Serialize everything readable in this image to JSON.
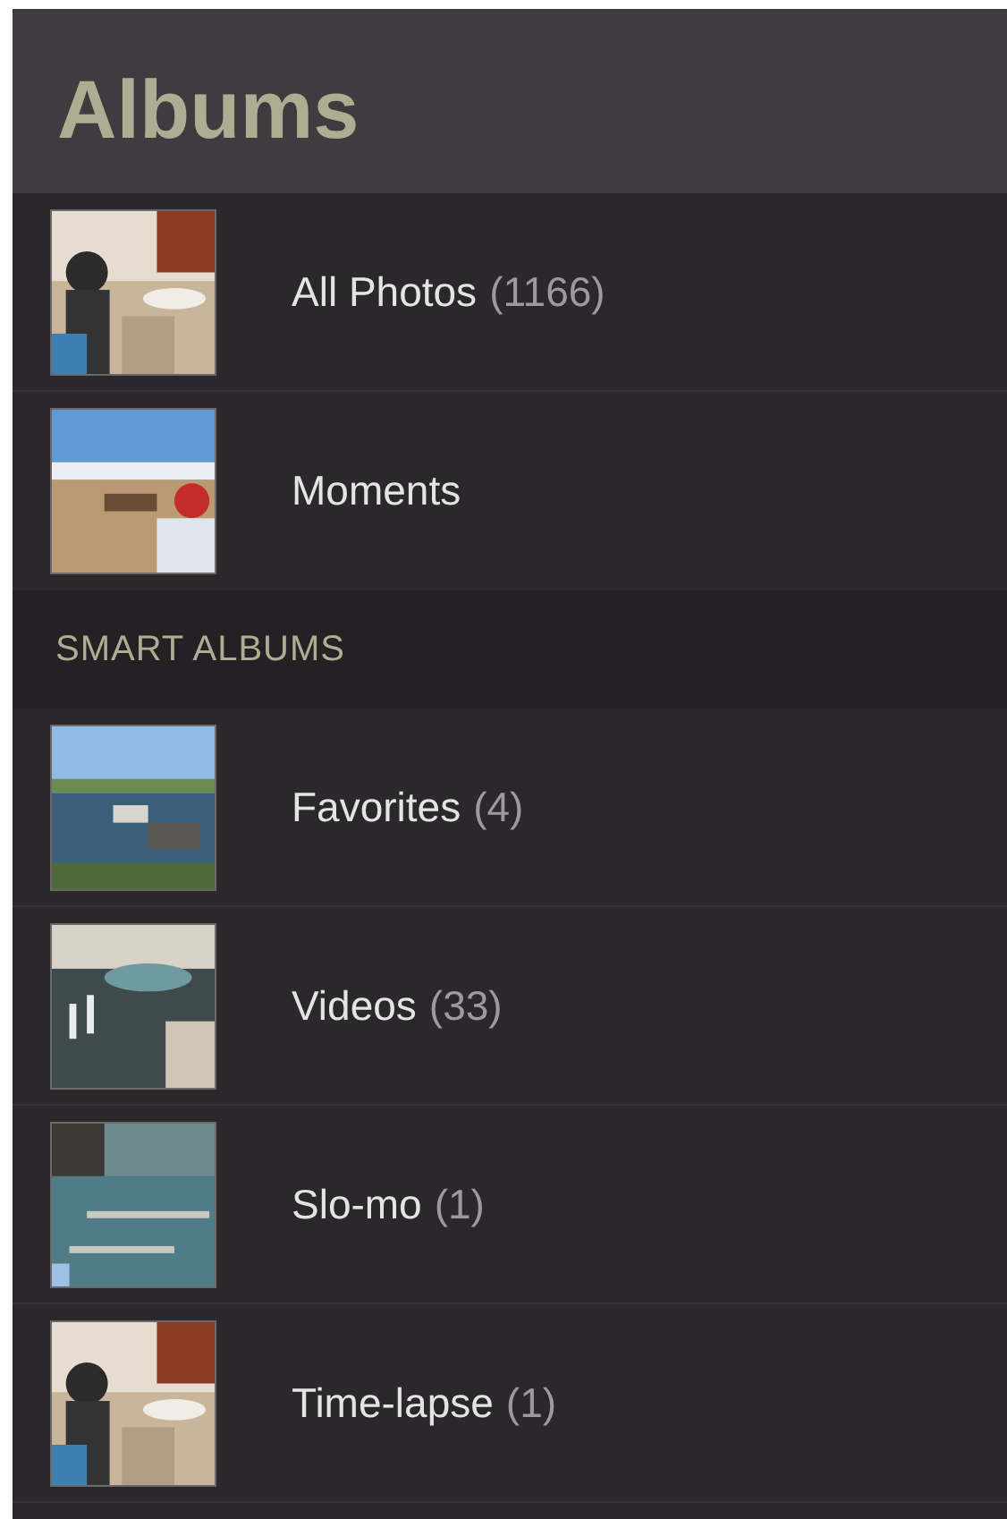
{
  "title": "Albums",
  "sections": [
    {
      "items": [
        {
          "name": "All Photos",
          "count": "(1166)"
        },
        {
          "name": "Moments"
        }
      ]
    },
    {
      "header": "SMART ALBUMS",
      "items": [
        {
          "name": "Favorites",
          "count": "(4)"
        },
        {
          "name": "Videos",
          "count": "(33)"
        },
        {
          "name": "Slo-mo",
          "count": "(1)"
        },
        {
          "name": "Time-lapse",
          "count": "(1)"
        }
      ]
    }
  ]
}
